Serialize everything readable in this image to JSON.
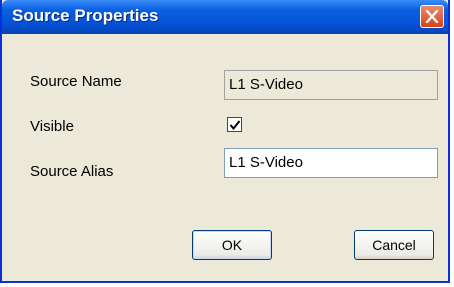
{
  "dialog": {
    "title": "Source Properties",
    "close_icon": "close-x",
    "fields": {
      "source_name_label": "Source Name",
      "source_name_value": "L1 S-Video",
      "visible_label": "Visible",
      "visible_checked": true,
      "source_alias_label": "Source Alias",
      "source_alias_value": "L1 S-Video"
    },
    "buttons": {
      "ok": "OK",
      "cancel": "Cancel"
    }
  }
}
